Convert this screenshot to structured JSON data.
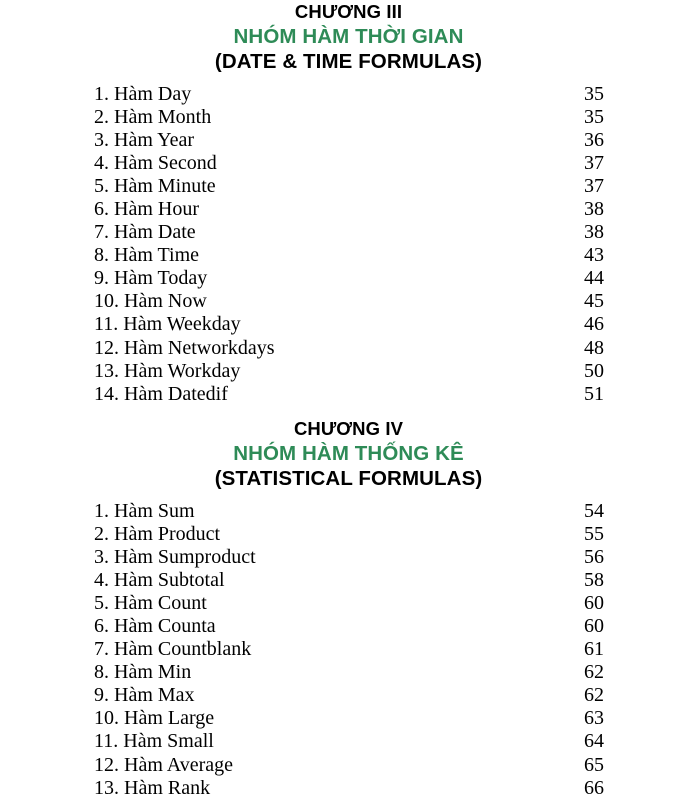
{
  "document": {
    "type": "table-of-contents",
    "language": "vi"
  },
  "theme": {
    "accent_green": "#2e8b57",
    "text_black": "#000000",
    "background": "#ffffff"
  },
  "sections": [
    {
      "heading": {
        "number": "CHƯƠNG III",
        "title_vi": "NHÓM HÀM THỜI GIAN",
        "title_en": "(DATE & TIME FORMULAS)"
      },
      "entries": [
        {
          "label": "1. Hàm Day",
          "page": "35"
        },
        {
          "label": "2. Hàm Month",
          "page": "35"
        },
        {
          "label": "3. Hàm Year",
          "page": "36"
        },
        {
          "label": "4. Hàm Second",
          "page": "37"
        },
        {
          "label": "5. Hàm Minute",
          "page": "37"
        },
        {
          "label": "6. Hàm Hour",
          "page": "38"
        },
        {
          "label": "7. Hàm Date",
          "page": "38"
        },
        {
          "label": "8. Hàm Time",
          "page": "43"
        },
        {
          "label": "9. Hàm Today",
          "page": "44"
        },
        {
          "label": "10. Hàm Now",
          "page": "45"
        },
        {
          "label": "11. Hàm Weekday",
          "page": "46"
        },
        {
          "label": "12. Hàm Networkdays",
          "page": "48"
        },
        {
          "label": "13. Hàm Workday",
          "page": "50"
        },
        {
          "label": "14. Hàm Datedif",
          "page": "51"
        }
      ]
    },
    {
      "heading": {
        "number": "CHƯƠNG IV",
        "title_vi": "NHÓM HÀM THỐNG KÊ",
        "title_en": "(STATISTICAL FORMULAS)"
      },
      "entries": [
        {
          "label": "1. Hàm Sum",
          "page": "54"
        },
        {
          "label": "2. Hàm Product",
          "page": "55"
        },
        {
          "label": "3. Hàm Sumproduct",
          "page": "56"
        },
        {
          "label": "4. Hàm Subtotal",
          "page": "58"
        },
        {
          "label": "5. Hàm Count",
          "page": "60"
        },
        {
          "label": "6. Hàm Counta",
          "page": "60"
        },
        {
          "label": "7. Hàm Countblank",
          "page": "61"
        },
        {
          "label": "8. Hàm Min",
          "page": "62"
        },
        {
          "label": "9. Hàm Max",
          "page": "62"
        },
        {
          "label": "10. Hàm Large",
          "page": "63"
        },
        {
          "label": "11. Hàm Small",
          "page": "64"
        },
        {
          "label": "12. Hàm Average",
          "page": "65"
        },
        {
          "label": "13. Hàm Rank",
          "page": "66"
        }
      ]
    }
  ]
}
